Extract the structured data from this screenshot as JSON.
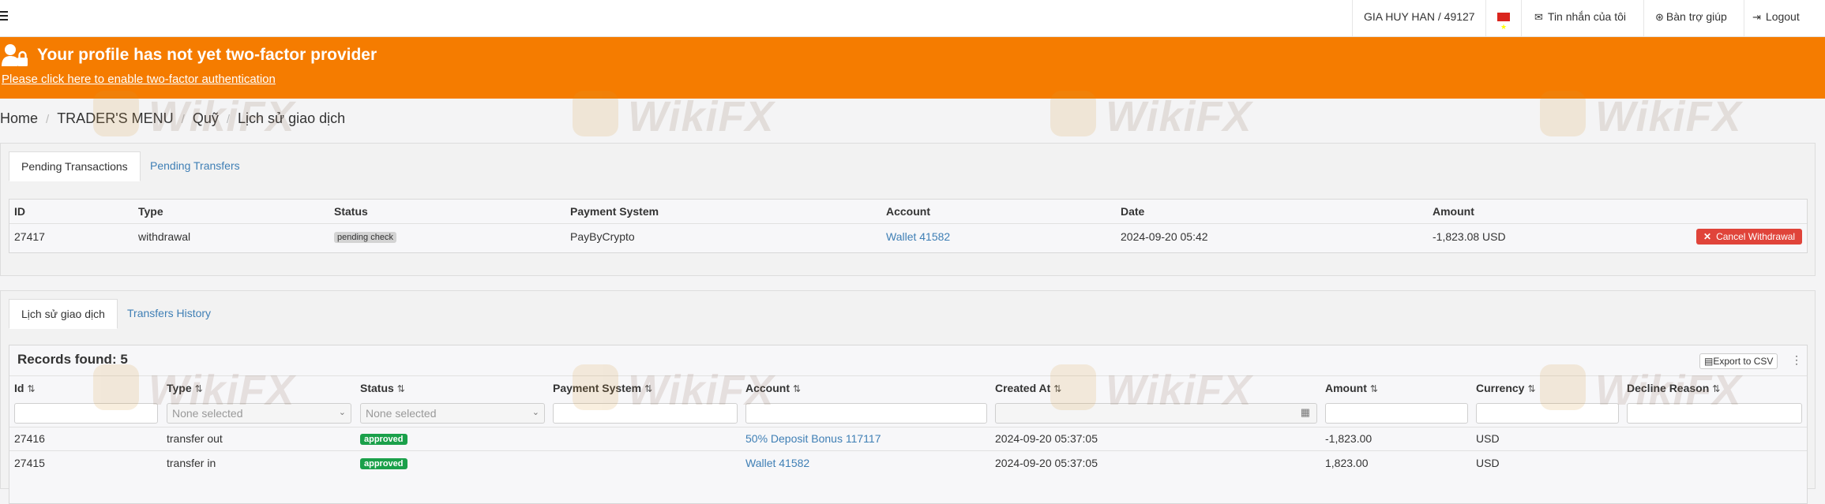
{
  "navbar": {
    "user_label": "GIA HUY HAN / 49127",
    "messages_label": "Tin nhắn của tôi",
    "help_label": "Bàn trợ giúp",
    "logout_label": "Logout"
  },
  "alert": {
    "title": "Your profile has not yet two-factor provider",
    "link_text": "Please click here to enable two-factor authentication",
    "background": "#f57c00"
  },
  "breadcrumb": [
    "Home",
    "TRADER'S MENU",
    "Quỹ",
    "Lịch sử giao dịch"
  ],
  "pending_panel": {
    "tabs": [
      "Pending Transactions",
      "Pending Transfers"
    ],
    "columns": [
      "ID",
      "Type",
      "Status",
      "Payment System",
      "Account",
      "Date",
      "Amount"
    ],
    "rows": [
      {
        "id": "27417",
        "type": "withdrawal",
        "status": "pending check",
        "payment_system": "PayByCrypto",
        "account": "Wallet 41582",
        "date": "2024-09-20 05:42",
        "amount": "-1,823.08 USD",
        "action": "Cancel Withdrawal"
      }
    ]
  },
  "history_panel": {
    "tabs": [
      "Lịch sử giao dịch",
      "Transfers History"
    ],
    "records_label": "Records found: 5",
    "export_label": "Export to CSV",
    "columns": [
      "Id",
      "Type",
      "Status",
      "Payment System",
      "Account",
      "Created At",
      "Amount",
      "Currency",
      "Decline Reason"
    ],
    "filters": {
      "type_placeholder": "None selected",
      "status_placeholder": "None selected"
    },
    "rows": [
      {
        "id": "27416",
        "type": "transfer out",
        "status": "approved",
        "payment_system": "",
        "account": "50% Deposit Bonus 117117",
        "created_at": "2024-09-20 05:37:05",
        "amount": "-1,823.00",
        "currency": "USD",
        "decline_reason": ""
      },
      {
        "id": "27415",
        "type": "transfer in",
        "status": "approved",
        "payment_system": "",
        "account": "Wallet 41582",
        "created_at": "2024-09-20 05:37:05",
        "amount": "1,823.00",
        "currency": "USD",
        "decline_reason": ""
      }
    ]
  },
  "watermark": "WikiFX",
  "colors": {
    "accent_orange": "#f57c00",
    "link_blue": "#3f7fb5",
    "approved_green": "#1aa04a",
    "danger_red": "#e0443a"
  }
}
